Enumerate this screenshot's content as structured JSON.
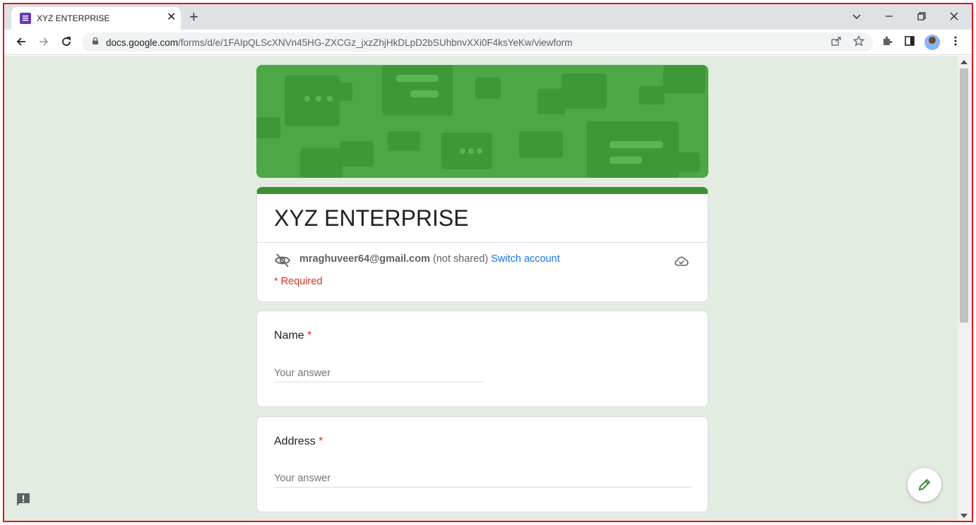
{
  "browser": {
    "tab_title": "XYZ ENTERPRISE",
    "url_host": "docs.google.com",
    "url_path": "/forms/d/e/1FAIpQLScXNVn45HG-ZXCGz_jxzZhjHkDLpD2bSUhbnvXXi0F4ksYeKw/viewform",
    "tab_close": "✕",
    "new_tab": "+"
  },
  "form": {
    "title": "XYZ ENTERPRISE",
    "account_email": "mraghuveer64@gmail.com",
    "not_shared": "(not shared)",
    "switch_account": "Switch account",
    "required_note": "* Required",
    "theme_color": "#3e8e36",
    "background_color": "#e3ece0",
    "questions": [
      {
        "label": "Name",
        "required_mark": "*",
        "placeholder": "Your answer"
      },
      {
        "label": "Address",
        "required_mark": "*",
        "placeholder": "Your answer"
      }
    ]
  }
}
